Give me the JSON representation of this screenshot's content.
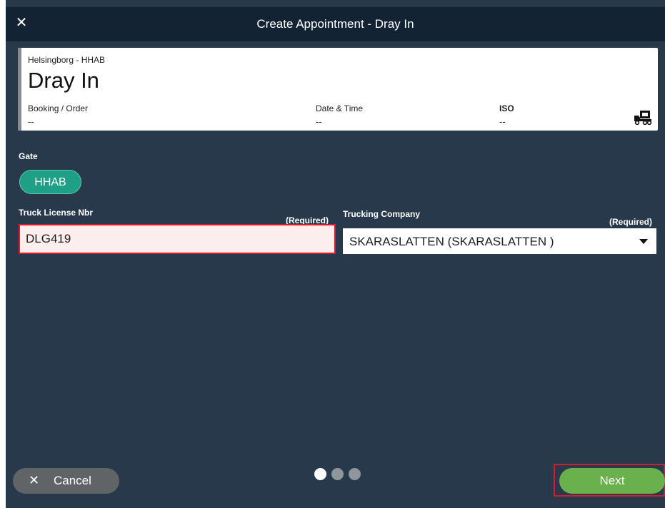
{
  "window": {
    "title": "Create Appointment - Dray In"
  },
  "summary": {
    "terminal": "Helsingborg - HHAB",
    "appointment_type": "Dray In",
    "fields": [
      {
        "label": "Booking / Order",
        "value": "--"
      },
      {
        "label": "Date & Time",
        "value": "--"
      },
      {
        "label": "ISO",
        "value": "--"
      }
    ],
    "icon": "truck-icon"
  },
  "gate": {
    "label": "Gate",
    "selected": "HHAB",
    "color": "#1e9f86"
  },
  "form": {
    "truck_license": {
      "label": "Truck License Nbr",
      "required_label": "(Required)",
      "value": "DLG419"
    },
    "trucking_company": {
      "label": "Trucking Company",
      "required_label": "(Required)",
      "value": "SKARASLATTEN (SKARASLATTEN )"
    }
  },
  "footer": {
    "cancel_label": "Cancel",
    "next_label": "Next",
    "pagination": {
      "total": 3,
      "current": 1
    }
  },
  "colors": {
    "background": "#27394b",
    "titlebar": "#132334",
    "next": "#6ab04c",
    "cancel": "#616466",
    "highlight": "#d51c2d"
  }
}
